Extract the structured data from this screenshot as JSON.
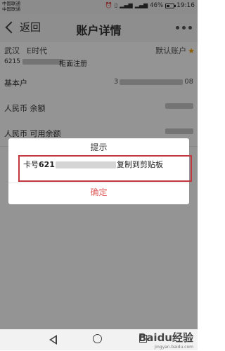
{
  "status_bar": {
    "carrier_1": "中国联通",
    "carrier_2": "中国联通",
    "battery_percent": "46%",
    "battery_level": 0.46,
    "time": "19:16",
    "icons": [
      "alarm-icon",
      "vibrate-icon",
      "signal-icon",
      "signal-icon",
      "battery-icon"
    ]
  },
  "nav": {
    "back_label": "返回",
    "title": "账户详情"
  },
  "account": {
    "city": "武汉",
    "name": "E时代",
    "default_label": "默认账户",
    "number_prefix": "6215",
    "status": "柜面注册"
  },
  "rows": [
    {
      "label": "基本户",
      "value_prefix": "3",
      "value_suffix": "08"
    },
    {
      "label": "人民币 余额"
    },
    {
      "label": "人民币 可用余额"
    }
  ],
  "dialog": {
    "title": "提示",
    "message_prefix": "卡号",
    "message_bold": "621",
    "message_suffix": "复制到剪贴板",
    "confirm_label": "确定"
  },
  "watermark": {
    "main": "Baidu经验",
    "sub": "jingyan.baidu.com"
  },
  "colors": {
    "highlight_border": "#c3383f",
    "confirm_text": "#e0605e",
    "star": "#f2a30a"
  }
}
